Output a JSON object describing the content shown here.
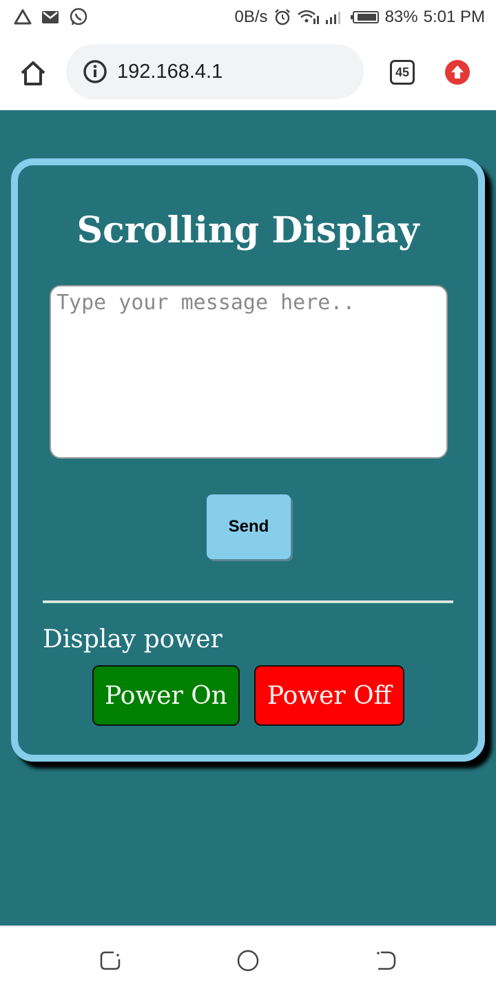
{
  "status_bar": {
    "left_icons": [
      "warning-triangle-icon",
      "gmail-icon",
      "whatsapp-icon"
    ],
    "net_speed": "0B/s",
    "battery": "83%",
    "time": "5:01 PM"
  },
  "browser": {
    "url": "192.168.4.1",
    "tab_count": "45"
  },
  "card": {
    "title": "Scrolling Display",
    "message_placeholder": "Type your message here..",
    "send_label": "Send",
    "power_label": "Display power",
    "power_on_label": "Power On",
    "power_off_label": "Power Off"
  },
  "colors": {
    "page_bg": "#24737b",
    "card_border": "#87ceeb",
    "send_bg": "#87ceeb",
    "power_on_bg": "#008000",
    "power_off_bg": "#ff0000",
    "update_icon": "#e53935"
  }
}
